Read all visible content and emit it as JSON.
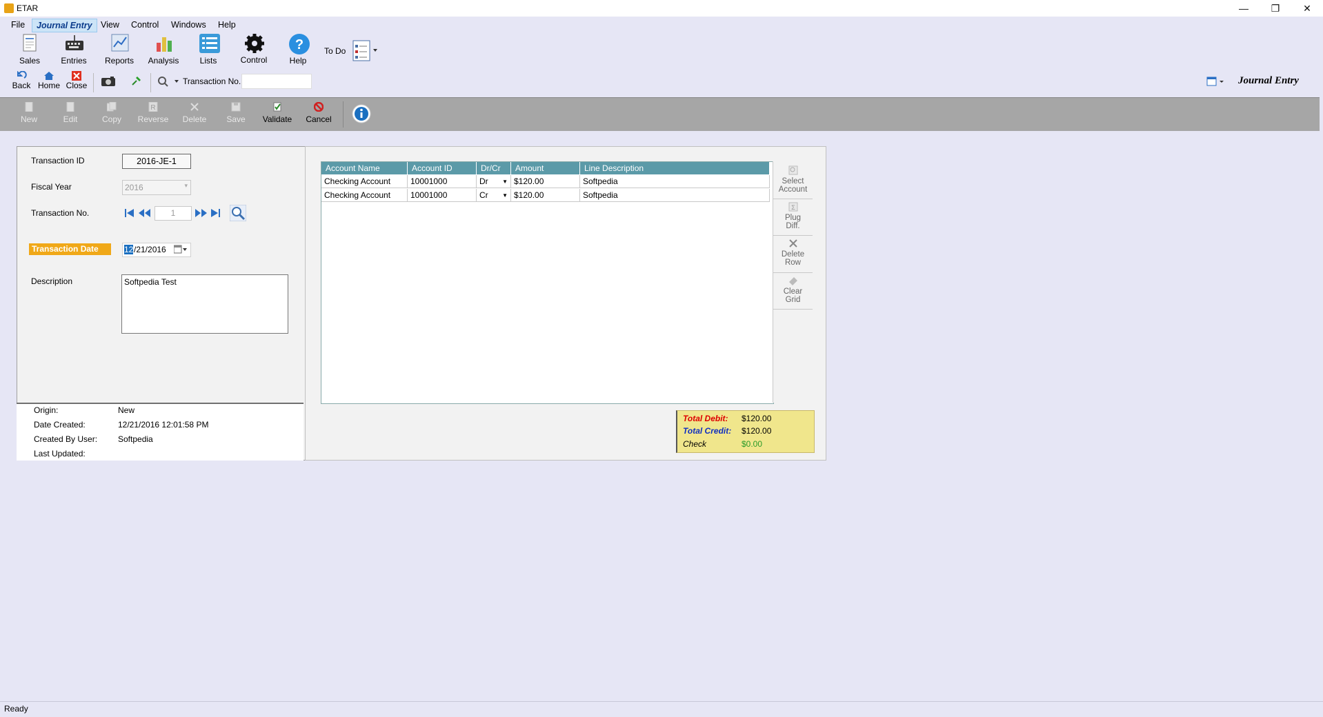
{
  "window": {
    "title": "ETAR",
    "minimize": "—",
    "restore": "❐",
    "close": "✕"
  },
  "menu": [
    "File",
    "Journal Entry",
    "View",
    "Control",
    "Windows",
    "Help"
  ],
  "ribbon": {
    "sales": "Sales",
    "entries": "Entries",
    "reports": "Reports",
    "analysis": "Analysis",
    "lists": "Lists",
    "control": "Control",
    "help": "Help",
    "todo": "To Do"
  },
  "nav": {
    "back": "Back",
    "home": "Home",
    "close": "Close",
    "transaction_no_label": "Transaction No.",
    "transaction_no_value": "",
    "module_title": "Journal Entry"
  },
  "actions": {
    "new": "New",
    "edit": "Edit",
    "copy": "Copy",
    "reverse": "Reverse",
    "delete": "Delete",
    "save": "Save",
    "validate": "Validate",
    "cancel": "Cancel"
  },
  "form": {
    "transaction_id_label": "Transaction ID",
    "transaction_id": "2016-JE-1",
    "fiscal_year_label": "Fiscal Year",
    "fiscal_year": "2016",
    "transaction_no_label": "Transaction No.",
    "transaction_no": "1",
    "transaction_date_label": "Transaction Date",
    "transaction_date_sel": "12",
    "transaction_date_rest": "/21/2016",
    "description_label": "Description",
    "description": "Softpedia Test"
  },
  "footer": {
    "origin_label": "Origin:",
    "origin": "New",
    "date_created_label": "Date Created:",
    "date_created": "12/21/2016 12:01:58 PM",
    "created_by_label": "Created By User:",
    "created_by": "Softpedia",
    "last_updated_label": "Last Updated:",
    "last_updated": ""
  },
  "grid": {
    "columns": [
      "Account Name",
      "Account ID",
      "Dr/Cr",
      "Amount",
      "Line Description"
    ],
    "rows": [
      [
        "Checking Account",
        "10001000",
        "Dr",
        "$120.00",
        "Softpedia"
      ],
      [
        "Checking Account",
        "10001000",
        "Cr",
        "$120.00",
        "Softpedia"
      ]
    ]
  },
  "side_buttons": {
    "select_1": "Select",
    "select_2": "Account",
    "plug_1": "Plug",
    "plug_2": "Diff.",
    "delete_1": "Delete",
    "delete_2": "Row",
    "clear_1": "Clear",
    "clear_2": "Grid"
  },
  "totals": {
    "debit_label": "Total Debit:",
    "debit": "$120.00",
    "credit_label": "Total Credit:",
    "credit": "$120.00",
    "check_label": "Check",
    "check": "$0.00"
  },
  "status": "Ready",
  "colors": {
    "grid_header": "#5b9aa8",
    "date_label": "#f0a818",
    "totals_bg": "#f0e68c"
  }
}
